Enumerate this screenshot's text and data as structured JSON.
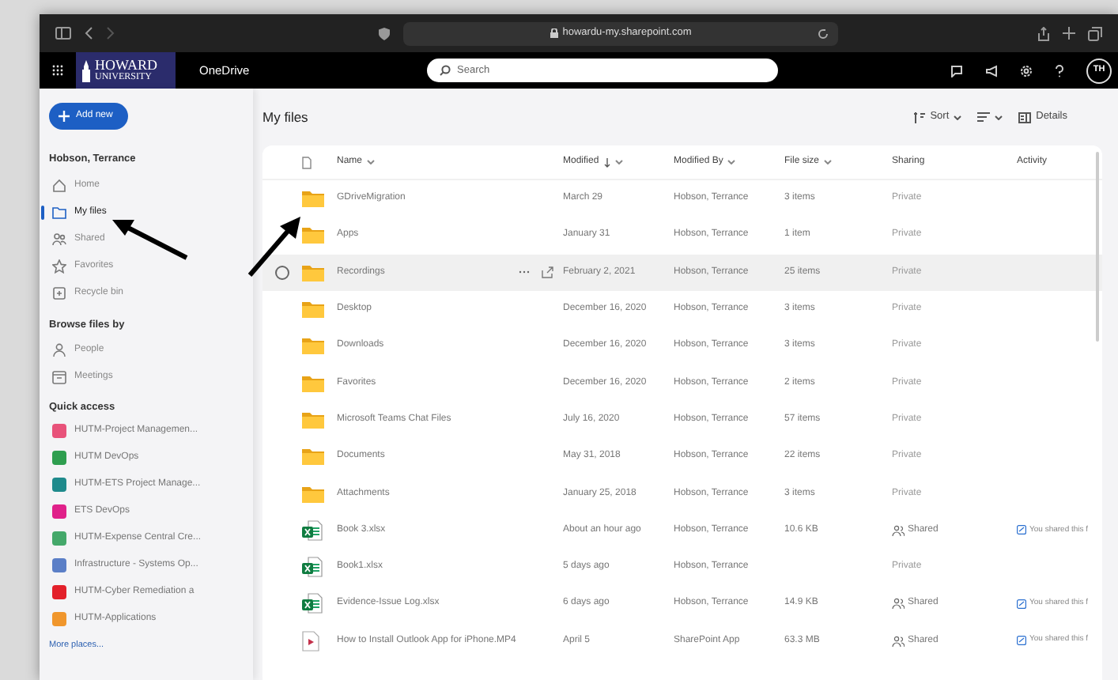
{
  "browser": {
    "url": "howardu-my.sharepoint.com"
  },
  "header": {
    "logo_top": "HOWARD",
    "logo_bottom": "UNIVERSITY",
    "app_name": "OneDrive",
    "search": {
      "placeholder": "Search"
    },
    "avatar": "TH"
  },
  "sidebar": {
    "add_button": "Add new",
    "user": "Hobson, Terrance",
    "items": [
      {
        "label": "Home",
        "selected": false
      },
      {
        "label": "My files",
        "selected": true
      },
      {
        "label": "Shared",
        "selected": false
      },
      {
        "label": "Favorites",
        "selected": false
      },
      {
        "label": "Recycle bin",
        "selected": false
      }
    ],
    "browse_heading": "Browse files by",
    "browse_items": [
      {
        "label": "People"
      },
      {
        "label": "Meetings"
      }
    ],
    "quick_heading": "Quick access",
    "quick_items": [
      {
        "label": "HUTM-Project Managemen...",
        "color": "#e8527a"
      },
      {
        "label": "HUTM DevOps",
        "color": "#2e9e4f"
      },
      {
        "label": "HUTM-ETS Project Manage...",
        "color": "#1f8a8c"
      },
      {
        "label": "ETS DevOps",
        "color": "#e0218a"
      },
      {
        "label": "HUTM-Expense Central Cre...",
        "color": "#44a86a"
      },
      {
        "label": "Infrastructure - Systems Op...",
        "color": "#5b7fc7"
      },
      {
        "label": "HUTM-Cyber Remediation a",
        "color": "#e3202a"
      },
      {
        "label": "HUTM-Applications",
        "color": "#f0962c"
      }
    ],
    "more_link": "More places..."
  },
  "main": {
    "title": "My files",
    "sort": "Sort",
    "details": "Details",
    "columns": [
      {
        "label": "Name",
        "sortable": true,
        "sorted": false
      },
      {
        "label": "Modified",
        "sortable": true,
        "sorted": true
      },
      {
        "label": "Modified By",
        "sortable": true,
        "sorted": false
      },
      {
        "label": "File size",
        "sortable": true,
        "sorted": false
      },
      {
        "label": "Sharing",
        "sortable": false,
        "sorted": false
      },
      {
        "label": "Activity",
        "sortable": false,
        "sorted": false
      }
    ],
    "rows": [
      {
        "kind": "folder",
        "name": "GDriveMigration",
        "modified": "March 29",
        "modified_by": "Hobson, Terrance",
        "size": "3 items",
        "sharing": "Private",
        "shared": false,
        "hovered": false
      },
      {
        "kind": "folder",
        "name": "Apps",
        "modified": "January 31",
        "modified_by": "Hobson, Terrance",
        "size": "1 item",
        "sharing": "Private",
        "shared": false,
        "hovered": false
      },
      {
        "kind": "folder",
        "name": "Recordings",
        "modified": "February 2, 2021",
        "modified_by": "Hobson, Terrance",
        "size": "25 items",
        "sharing": "Private",
        "shared": false,
        "hovered": true
      },
      {
        "kind": "folder",
        "name": "Desktop",
        "modified": "December 16, 2020",
        "modified_by": "Hobson, Terrance",
        "size": "3 items",
        "sharing": "Private",
        "shared": false,
        "hovered": false
      },
      {
        "kind": "folder",
        "name": "Downloads",
        "modified": "December 16, 2020",
        "modified_by": "Hobson, Terrance",
        "size": "3 items",
        "sharing": "Private",
        "shared": false,
        "hovered": false
      },
      {
        "kind": "folder",
        "name": "Favorites",
        "modified": "December 16, 2020",
        "modified_by": "Hobson, Terrance",
        "size": "2 items",
        "sharing": "Private",
        "shared": false,
        "hovered": false
      },
      {
        "kind": "folder",
        "name": "Microsoft Teams Chat Files",
        "modified": "July 16, 2020",
        "modified_by": "Hobson, Terrance",
        "size": "57 items",
        "sharing": "Private",
        "shared": false,
        "hovered": false
      },
      {
        "kind": "folder",
        "name": "Documents",
        "modified": "May 31, 2018",
        "modified_by": "Hobson, Terrance",
        "size": "22 items",
        "sharing": "Private",
        "shared": false,
        "hovered": false
      },
      {
        "kind": "folder",
        "name": "Attachments",
        "modified": "January 25, 2018",
        "modified_by": "Hobson, Terrance",
        "size": "3 items",
        "sharing": "Private",
        "shared": false,
        "hovered": false
      },
      {
        "kind": "excel",
        "name": "Book 3.xlsx",
        "modified": "About an hour ago",
        "modified_by": "Hobson, Terrance",
        "size": "10.6 KB",
        "sharing": "Shared",
        "shared": true,
        "activity": "You shared this f",
        "hovered": false
      },
      {
        "kind": "excel",
        "name": "Book1.xlsx",
        "modified": "5 days ago",
        "modified_by": "Hobson, Terrance",
        "sharing": "Private",
        "shared": false,
        "hovered": false
      },
      {
        "kind": "excel",
        "name": "Evidence-Issue Log.xlsx",
        "modified": "6 days ago",
        "modified_by": "Hobson, Terrance",
        "size": "14.9 KB",
        "sharing": "Shared",
        "shared": true,
        "activity": "You shared this f",
        "hovered": false
      },
      {
        "kind": "video",
        "name": "How to Install Outlook App for iPhone.MP4",
        "modified": "April 5",
        "modified_by": "SharePoint App",
        "size": "63.3 MB",
        "sharing": "Shared",
        "shared": true,
        "activity": "You shared this f",
        "hovered": false
      }
    ]
  }
}
